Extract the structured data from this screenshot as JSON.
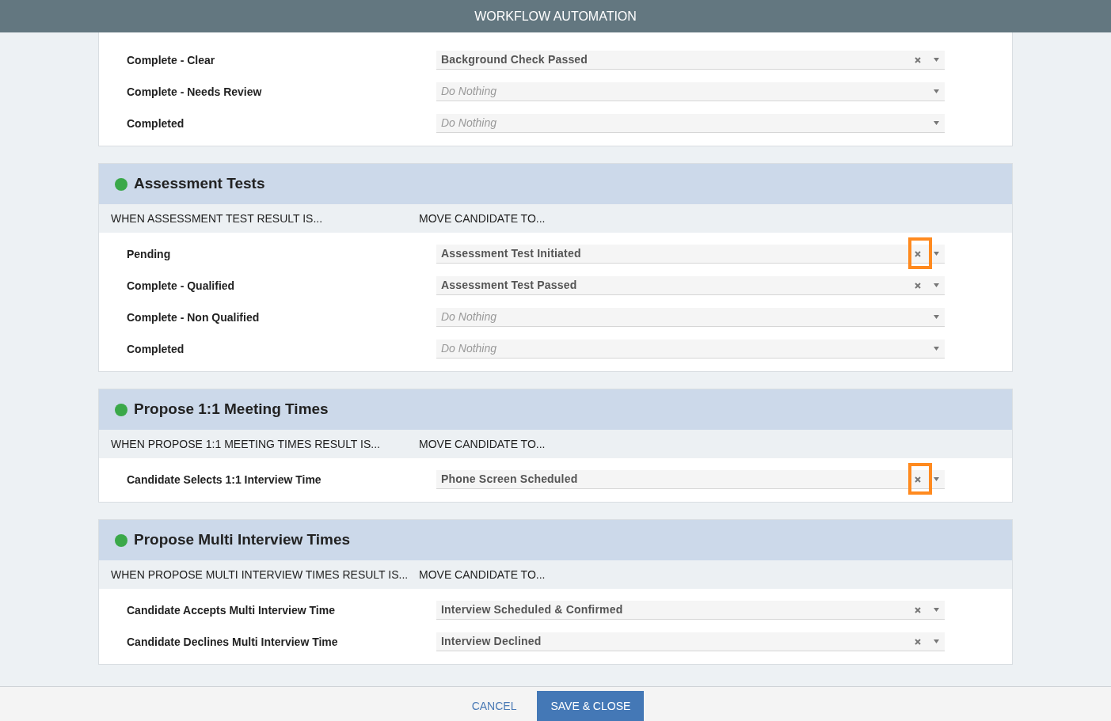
{
  "title": "WORKFLOW AUTOMATION",
  "sections": [
    {
      "rows": [
        {
          "label": "Complete - Clear",
          "select": {
            "value": "Background Check Passed",
            "highlighted": false
          }
        },
        {
          "label": "Complete - Needs Review",
          "select": {
            "placeholder": "Do Nothing"
          }
        },
        {
          "label": "Completed",
          "select": {
            "placeholder": "Do Nothing"
          }
        }
      ]
    },
    {
      "title": "Assessment Tests",
      "color": "#3aa849",
      "when_heading": "WHEN ASSESSMENT TEST RESULT IS...",
      "move_heading": "MOVE CANDIDATE TO...",
      "rows": [
        {
          "label": "Pending",
          "select": {
            "value": "Assessment Test Initiated",
            "highlighted": true
          }
        },
        {
          "label": "Complete - Qualified",
          "select": {
            "value": "Assessment Test Passed",
            "highlighted": false
          }
        },
        {
          "label": "Complete - Non Qualified",
          "select": {
            "placeholder": "Do Nothing"
          }
        },
        {
          "label": "Completed",
          "select": {
            "placeholder": "Do Nothing"
          }
        }
      ]
    },
    {
      "title": "Propose 1:1 Meeting Times",
      "color": "#3aa849",
      "when_heading": "WHEN PROPOSE 1:1 MEETING TIMES RESULT IS...",
      "move_heading": "MOVE CANDIDATE TO...",
      "rows": [
        {
          "label": "Candidate Selects 1:1 Interview Time",
          "select": {
            "value": "Phone Screen Scheduled",
            "highlighted": true
          }
        }
      ]
    },
    {
      "title": "Propose Multi Interview Times",
      "color": "#3aa849",
      "when_heading": "WHEN PROPOSE MULTI INTERVIEW TIMES RESULT IS...",
      "move_heading": "MOVE CANDIDATE TO...",
      "rows": [
        {
          "label": "Candidate Accepts Multi Interview Time",
          "select": {
            "value": "Interview Scheduled & Confirmed",
            "highlighted": false
          }
        },
        {
          "label": "Candidate Declines Multi Interview Time",
          "select": {
            "value": "Interview Declined",
            "highlighted": false
          }
        }
      ]
    }
  ],
  "footer": {
    "cancel": "CANCEL",
    "save": "SAVE & CLOSE"
  }
}
